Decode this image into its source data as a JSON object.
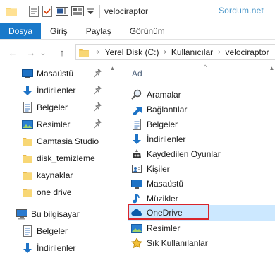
{
  "titlebar": {
    "window_title": "velociraptor",
    "watermark": "Sordum.net",
    "quick_access_icons": [
      "folder-icon",
      "properties-icon",
      "checkmark-doc-icon",
      "rename-icon",
      "view-icon",
      "dropdown-arrow-icon"
    ]
  },
  "ribbon": {
    "tabs": [
      {
        "label": "Dosya",
        "active": true
      },
      {
        "label": "Giriş",
        "active": false
      },
      {
        "label": "Paylaş",
        "active": false
      },
      {
        "label": "Görünüm",
        "active": false
      }
    ]
  },
  "nav": {
    "back": "←",
    "forward": "→",
    "recent": "⌄",
    "up": "↑"
  },
  "address": {
    "overflow": "«",
    "segments": [
      "Yerel Disk (C:)",
      "Kullanıcılar",
      "velociraptor"
    ]
  },
  "navpane": {
    "quick_access": [
      {
        "label": "Masaüstü",
        "icon": "desktop-icon",
        "pinned": true
      },
      {
        "label": "İndirilenler",
        "icon": "download-arrow-icon",
        "pinned": true
      },
      {
        "label": "Belgeler",
        "icon": "documents-icon",
        "pinned": true
      },
      {
        "label": "Resimler",
        "icon": "pictures-icon",
        "pinned": true
      },
      {
        "label": "Camtasia Studio",
        "icon": "folder-icon",
        "pinned": false
      },
      {
        "label": "disk_temizleme",
        "icon": "folder-icon",
        "pinned": false
      },
      {
        "label": "kaynaklar",
        "icon": "folder-icon",
        "pinned": false
      },
      {
        "label": "one drive",
        "icon": "folder-icon",
        "pinned": false
      }
    ],
    "this_pc": {
      "label": "Bu bilgisayar",
      "icon": "computer-icon"
    },
    "pc_items": [
      {
        "label": "Belgeler",
        "icon": "documents-icon"
      },
      {
        "label": "İndirilenler",
        "icon": "download-arrow-icon"
      }
    ]
  },
  "content": {
    "column_header": "Ad",
    "items": [
      {
        "label": "Aramalar",
        "icon": "search-icon"
      },
      {
        "label": "Bağlantılar",
        "icon": "links-icon"
      },
      {
        "label": "Belgeler",
        "icon": "documents-icon"
      },
      {
        "label": "İndirilenler",
        "icon": "download-arrow-icon"
      },
      {
        "label": "Kaydedilen Oyunlar",
        "icon": "saved-games-icon"
      },
      {
        "label": "Kişiler",
        "icon": "contacts-icon"
      },
      {
        "label": "Masaüstü",
        "icon": "desktop-icon"
      },
      {
        "label": "Müzikler",
        "icon": "music-icon"
      },
      {
        "label": "OneDrive",
        "icon": "onedrive-cloud-icon",
        "selected": true
      },
      {
        "label": "Resimler",
        "icon": "pictures-icon"
      },
      {
        "label": "Sık Kullanılanlar",
        "icon": "favorites-star-icon"
      }
    ]
  },
  "colors": {
    "accent": "#1979ca",
    "selection": "#cce8ff",
    "highlight_box": "#d9252b",
    "folder": "#f8d775"
  }
}
